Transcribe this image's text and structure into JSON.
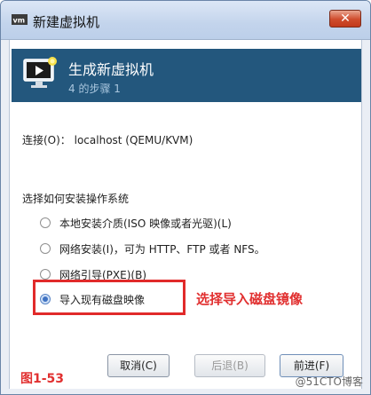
{
  "window": {
    "title": "新建虚拟机",
    "close_label": "✕",
    "icon": "vm-app-icon"
  },
  "banner": {
    "title": "生成新虚拟机",
    "step": "4 的步骤 1",
    "icon": "monitor-play-icon"
  },
  "connection": {
    "text": "连接(O)： localhost (QEMU/KVM)"
  },
  "install": {
    "section_label": "选择如何安装操作系统",
    "options": [
      {
        "label": "本地安装介质(ISO 映像或者光驱)(L)",
        "checked": false
      },
      {
        "label": "网络安装(I)，可为 HTTP、FTP 或者 NFS。",
        "checked": false
      },
      {
        "label": "网络引导(PXE)(B)",
        "checked": false
      },
      {
        "label": "导入现有磁盘映像",
        "checked": true
      }
    ]
  },
  "annotation": {
    "text": "选择导入磁盘镜像",
    "figure": "图1-53",
    "color": "#e13030"
  },
  "buttons": {
    "cancel": "取消(C)",
    "back": "后退(B)",
    "forward": "前进(F)"
  },
  "watermark": "@51CTO博客"
}
